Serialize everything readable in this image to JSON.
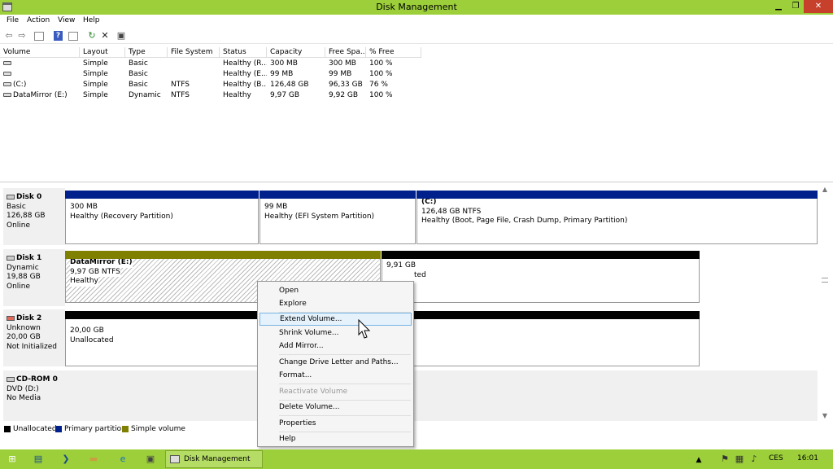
{
  "window": {
    "title": "Disk Management"
  },
  "menu": [
    "File",
    "Action",
    "View",
    "Help"
  ],
  "toolbar": {
    "icons": [
      "back-arrow-icon",
      "forward-arrow-icon",
      "console-tree-icon",
      "help-icon",
      "properties-icon",
      "refresh-icon",
      "delete-icon",
      "settings-icon"
    ]
  },
  "volume_table": {
    "columns": [
      "Volume",
      "Layout",
      "Type",
      "File System",
      "Status",
      "Capacity",
      "Free Spa...",
      "% Free"
    ],
    "rows": [
      [
        "",
        "Simple",
        "Basic",
        "",
        "Healthy (R...",
        "300 MB",
        "300 MB",
        "100 %"
      ],
      [
        "",
        "Simple",
        "Basic",
        "",
        "Healthy (E...",
        "99 MB",
        "99 MB",
        "100 %"
      ],
      [
        "(C:)",
        "Simple",
        "Basic",
        "NTFS",
        "Healthy (B...",
        "126,48 GB",
        "96,33 GB",
        "76 %"
      ],
      [
        "DataMirror (E:)",
        "Simple",
        "Dynamic",
        "NTFS",
        "Healthy",
        "9,97 GB",
        "9,92 GB",
        "100 %"
      ]
    ]
  },
  "disks": [
    {
      "name": "Disk 0",
      "type": "Basic",
      "size": "126,88 GB",
      "status": "Online"
    },
    {
      "name": "Disk 1",
      "type": "Dynamic",
      "size": "19,88 GB",
      "status": "Online"
    },
    {
      "name": "Disk 2",
      "type": "Unknown",
      "size": "20,00 GB",
      "status": "Not Initialized"
    },
    {
      "name": "CD-ROM 0",
      "type": "DVD (D:)",
      "size": "",
      "status": "No Media"
    }
  ],
  "partitions": {
    "d0p1": {
      "size": "300 MB",
      "status": "Healthy (Recovery Partition)"
    },
    "d0p2": {
      "size": "99 MB",
      "status": "Healthy (EFI System Partition)"
    },
    "d0p3": {
      "name": "(C:)",
      "size": "126,48 GB NTFS",
      "status": "Healthy (Boot, Page File, Crash Dump, Primary Partition)"
    },
    "d1p1": {
      "name": "DataMirror  (E:)",
      "size": "9,97 GB NTFS",
      "status": "Healthy"
    },
    "d1p2": {
      "size": "9,91 GB",
      "status": "ted"
    },
    "d2p1": {
      "size": "20,00 GB",
      "status": "Unallocated"
    }
  },
  "legend": [
    {
      "label": "Unallocated",
      "color": "#000000"
    },
    {
      "label": "Primary partition",
      "color": "#00208c"
    },
    {
      "label": "Simple volume",
      "color": "#808000"
    }
  ],
  "context_menu": {
    "items": [
      {
        "label": "Open",
        "enabled": true
      },
      {
        "label": "Explore",
        "enabled": true
      },
      {
        "label": "Extend Volume...",
        "enabled": true,
        "highlighted": true
      },
      {
        "label": "Shrink Volume...",
        "enabled": true
      },
      {
        "label": "Add Mirror...",
        "enabled": true
      },
      {
        "label": "Change Drive Letter and Paths...",
        "enabled": true
      },
      {
        "label": "Format...",
        "enabled": true
      },
      {
        "label": "Reactivate Volume",
        "enabled": false
      },
      {
        "label": "Delete Volume...",
        "enabled": true
      },
      {
        "label": "Properties",
        "enabled": true
      },
      {
        "label": "Help",
        "enabled": true
      }
    ]
  },
  "taskbar": {
    "app_label": "Disk Management",
    "language": "CES",
    "time": "16:01"
  },
  "colors": {
    "accent": "#9ccf3a",
    "primary_partition": "#00208c",
    "simple_volume": "#808000",
    "unallocated": "#000000"
  }
}
